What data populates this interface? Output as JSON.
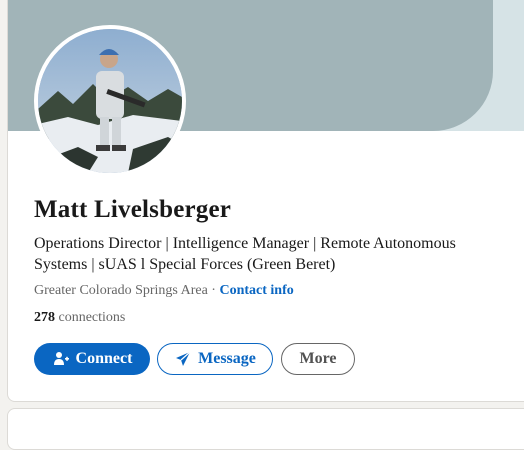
{
  "profile": {
    "name": "Matt Livelsberger",
    "headline": "Operations Director | Intelligence Manager | Remote Autonomous Systems | sUAS l Special Forces (Green Beret)",
    "location": "Greater Colorado Springs Area",
    "separator": "·",
    "contact_label": "Contact info",
    "connections_count": "278",
    "connections_label": "connections"
  },
  "actions": {
    "connect_label": "Connect",
    "message_label": "Message",
    "more_label": "More"
  },
  "colors": {
    "accent": "#0a66c2",
    "cover": "#a1b4b8",
    "cover_right": "#d6e3e6"
  },
  "icons": {
    "connect": "add-person-icon",
    "message": "send-icon"
  }
}
